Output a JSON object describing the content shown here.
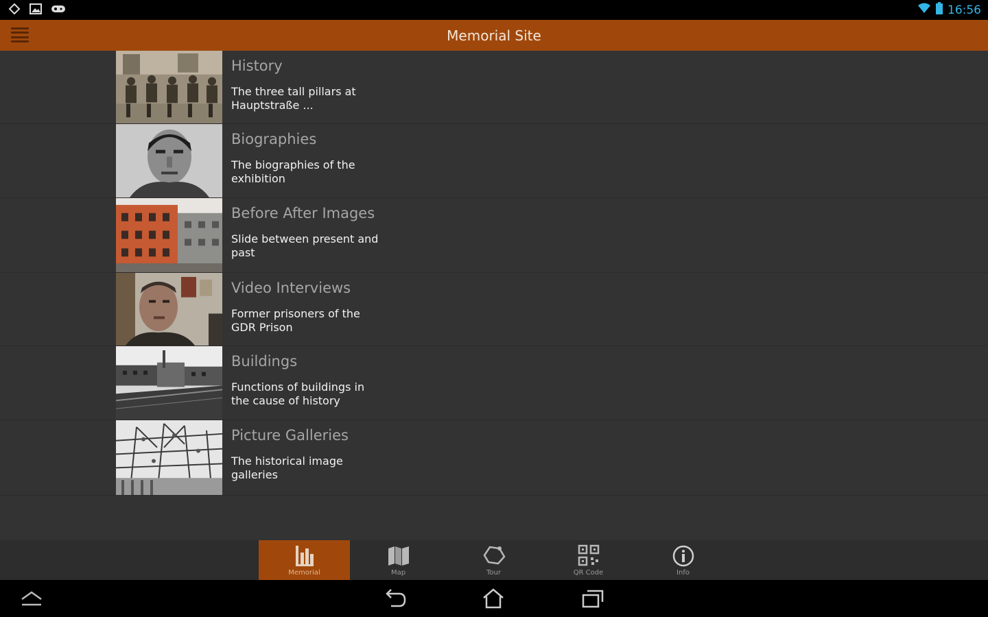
{
  "status_bar": {
    "time": "16:56"
  },
  "action_bar": {
    "title": "Memorial Site"
  },
  "list": {
    "items": [
      {
        "title": "History",
        "subtitle": "The three tall pillars at Hauptstraße ...",
        "image": "photo-seated-group-sepia"
      },
      {
        "title": "Biographies",
        "subtitle": "The biographies of the exhibition",
        "image": "photo-portrait-man"
      },
      {
        "title": "Before After Images",
        "subtitle": "Slide between present and past",
        "image": "photo-red-building"
      },
      {
        "title": "Video Interviews",
        "subtitle": "Former prisoners of the GDR Prison",
        "image": "photo-interview-man"
      },
      {
        "title": "Buildings",
        "subtitle": "Functions of buildings in the cause of history",
        "image": "photo-prison-buildings"
      },
      {
        "title": "Picture Galleries",
        "subtitle": "The historical image galleries",
        "image": "photo-barbed-wire"
      }
    ]
  },
  "tabs": [
    {
      "label": "Memorial",
      "icon": "bar-chart-icon",
      "active": true
    },
    {
      "label": "Map",
      "icon": "map-icon",
      "active": false
    },
    {
      "label": "Tour",
      "icon": "tour-icon",
      "active": false
    },
    {
      "label": "QR Code",
      "icon": "qr-code-icon",
      "active": false
    },
    {
      "label": "Info",
      "icon": "info-icon",
      "active": false
    }
  ],
  "colors": {
    "accent": "#a0480b",
    "background": "#333333",
    "title_text": "#a6a6a6",
    "status_blue": "#33b5e5"
  }
}
